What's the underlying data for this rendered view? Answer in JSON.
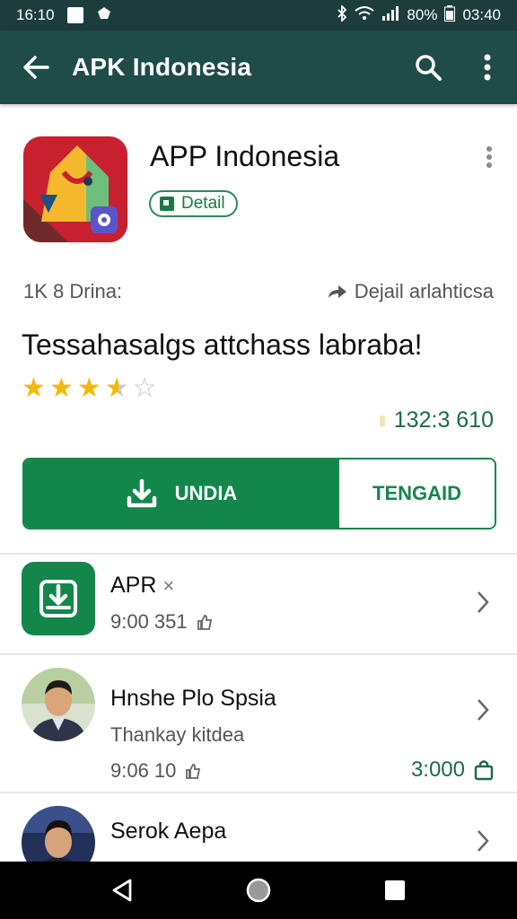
{
  "status_bar": {
    "time": "16:10",
    "battery_text": "80%",
    "clock_right": "03:40",
    "icons": [
      "notification-square-icon",
      "app-notification-icon",
      "bluetooth-icon",
      "wifi-icon",
      "signal-icon",
      "battery-icon"
    ]
  },
  "app_bar": {
    "title": "APK Indonesia",
    "icons": [
      "back-arrow-icon",
      "search-icon",
      "more-vert-icon"
    ]
  },
  "app_header": {
    "name": "APP Indonesia",
    "detail_chip": "Detail",
    "meta_left": "1K 8 Drina:",
    "meta_right": "Dejail arlahticsa",
    "headline": "Tessahasalgs attchass labraba!",
    "rating": 3.5,
    "rating_max": 5,
    "count": "132:3 610",
    "primary_button": "UNDIA",
    "secondary_button": "TENGAID"
  },
  "list": {
    "items": [
      {
        "title": "APR",
        "title_suffix": "×",
        "meta": "9:00 351",
        "icon": "download-icon"
      },
      {
        "title": "Hnshe Plo Spsia",
        "subtitle": "Thankay kitdea",
        "meta": "9:06 10",
        "price": "3:000",
        "icon": "avatar-man-icon"
      },
      {
        "title": "Serok Aepa",
        "icon": "avatar-man-icon"
      }
    ]
  },
  "colors": {
    "status_bar": "#1d3d3d",
    "app_bar": "#1f4b48",
    "accent_green": "#13874b",
    "star": "#f5b800"
  }
}
